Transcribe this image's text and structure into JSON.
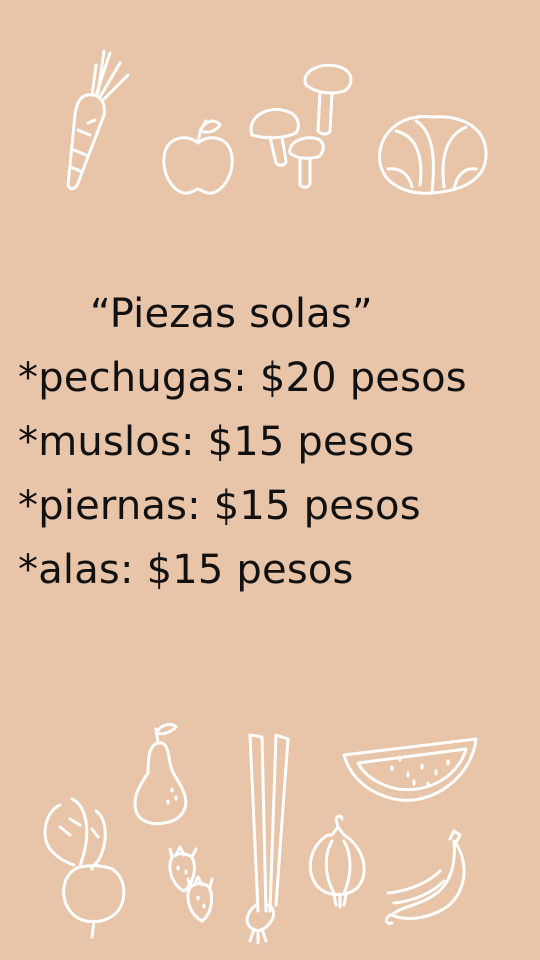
{
  "card": {
    "title": "“Piezas solas”",
    "items": [
      {
        "text": "*pechugas: $20 pesos"
      },
      {
        "text": "*muslos: $15 pesos"
      },
      {
        "text": "*piernas: $15 pesos"
      },
      {
        "text": "*alas: $15 pesos"
      }
    ]
  },
  "colors": {
    "background": "#e8c4a8",
    "text": "#111111",
    "line_art": "#ffffff"
  },
  "icons": {
    "top": [
      "carrot-icon",
      "apple-icon",
      "mushrooms-icon",
      "cabbage-icon"
    ],
    "bottom": [
      "pear-icon",
      "leek-icon",
      "watermelon-slice-icon",
      "beet-icon",
      "strawberries-icon",
      "onion-icon",
      "bananas-icon"
    ]
  }
}
